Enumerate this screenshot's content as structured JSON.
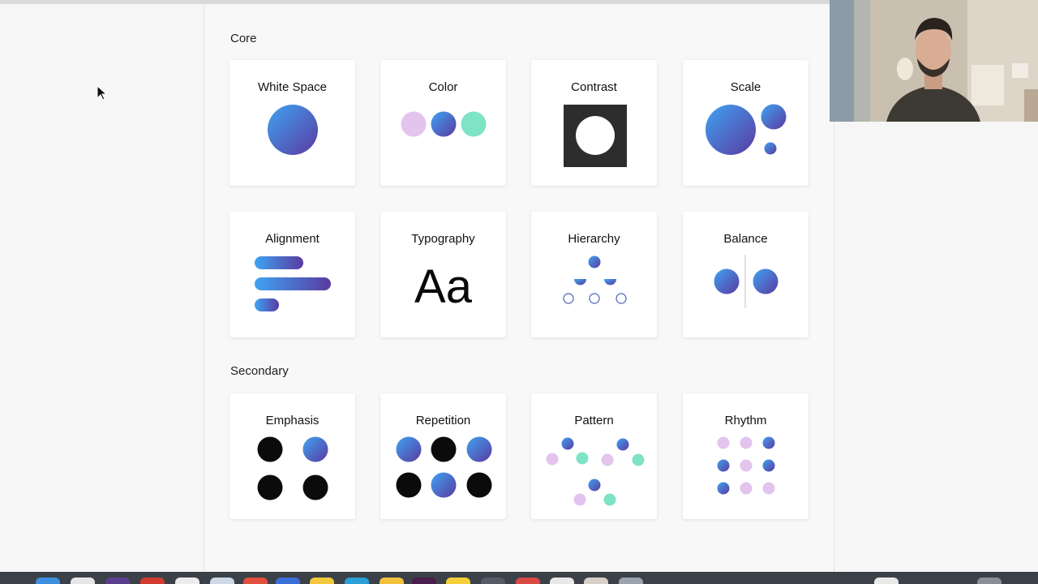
{
  "sections": {
    "core": "Core",
    "secondary": "Secondary"
  },
  "cards": {
    "white_space": "White Space",
    "color": "Color",
    "contrast": "Contrast",
    "scale": "Scale",
    "alignment": "Alignment",
    "typography": "Typography",
    "typography_sample": "Aa",
    "hierarchy": "Hierarchy",
    "balance": "Balance",
    "emphasis": "Emphasis",
    "repetition": "Repetition",
    "pattern": "Pattern",
    "rhythm": "Rhythm"
  },
  "colors": {
    "gradient_start": "#3fa3f2",
    "gradient_end": "#5a3aa0",
    "pink": "#e2c4ee",
    "mint": "#7fe3c6",
    "black": "#0b0b0b",
    "dark_square": "#2d2d2d"
  },
  "dock": {
    "icons": [
      "finder-icon",
      "safari-icon",
      "chrome-icon",
      "mail-icon",
      "app-icon",
      "app-icon",
      "app-icon",
      "app-icon",
      "notes-icon",
      "app-icon",
      "slack-icon",
      "app-icon",
      "app-icon",
      "app-icon",
      "app-icon",
      "app-icon",
      "app-icon",
      "app-icon",
      "app-icon",
      "app-icon"
    ]
  }
}
